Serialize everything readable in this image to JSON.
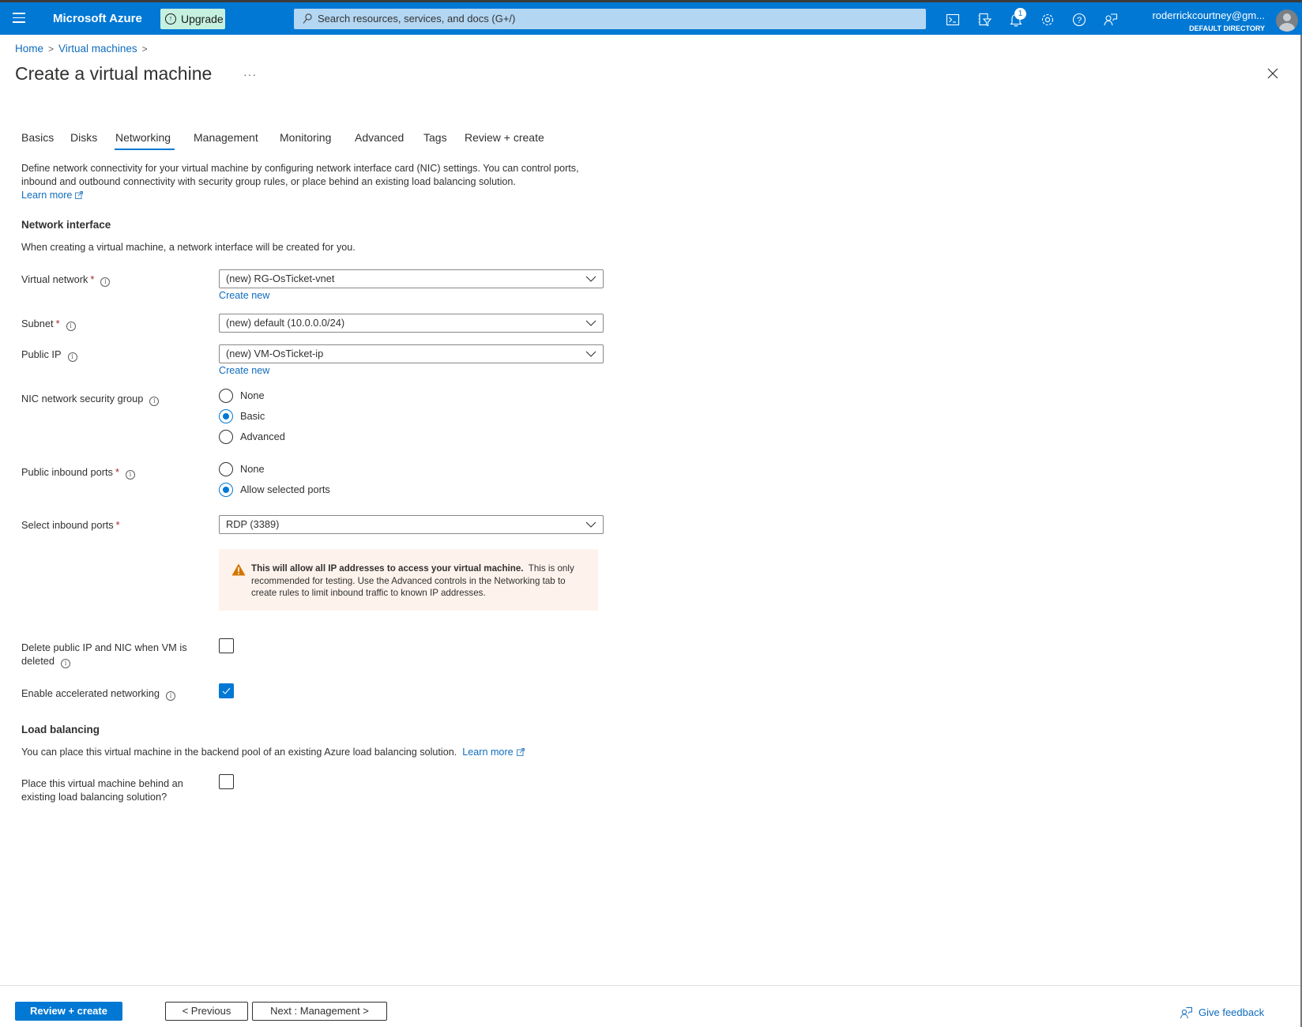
{
  "topbar": {
    "brand": "Microsoft Azure",
    "upgrade_label": "Upgrade",
    "search_placeholder": "Search resources, services, and docs (G+/)",
    "notification_count": "1",
    "user_email": "roderrickcourtney@gm...",
    "user_directory": "DEFAULT DIRECTORY",
    "icons": [
      "cloud-shell-icon",
      "directory-filter-icon",
      "notifications-icon",
      "settings-icon",
      "help-icon",
      "feedback-icon"
    ]
  },
  "breadcrumb": [
    "Home",
    "Virtual machines"
  ],
  "page": {
    "title": "Create a virtual machine",
    "more_label": "···"
  },
  "tabs": [
    {
      "label": "Basics",
      "active": false
    },
    {
      "label": "Disks",
      "active": false
    },
    {
      "label": "Networking",
      "active": true
    },
    {
      "label": "Management",
      "active": false
    },
    {
      "label": "Monitoring",
      "active": false
    },
    {
      "label": "Advanced",
      "active": false
    },
    {
      "label": "Tags",
      "active": false
    },
    {
      "label": "Review + create",
      "active": false
    }
  ],
  "intro": {
    "text": "Define network connectivity for your virtual machine by configuring network interface card (NIC) settings. You can control ports, inbound and outbound connectivity with security group rules, or place behind an existing load balancing solution.",
    "learn_more": "Learn more"
  },
  "network_interface": {
    "heading": "Network interface",
    "subtitle": "When creating a virtual machine, a network interface will be created for you.",
    "virtual_network": {
      "label": "Virtual network",
      "value": "(new) RG-OsTicket-vnet",
      "create_new": "Create new"
    },
    "subnet": {
      "label": "Subnet",
      "value": "(new) default (10.0.0.0/24)"
    },
    "public_ip": {
      "label": "Public IP",
      "value": "(new) VM-OsTicket-ip",
      "create_new": "Create new"
    },
    "nic_nsg": {
      "label": "NIC network security group",
      "options": [
        "None",
        "Basic",
        "Advanced"
      ],
      "selected": "Basic"
    },
    "public_inbound_ports": {
      "label": "Public inbound ports",
      "options": [
        "None",
        "Allow selected ports"
      ],
      "selected": "Allow selected ports"
    },
    "select_inbound_ports": {
      "label": "Select inbound ports",
      "value": "RDP (3389)"
    },
    "warning": {
      "bold": "This will allow all IP addresses to access your virtual machine.",
      "text": "This is only recommended for testing.  Use the Advanced controls in the Networking tab to create rules to limit inbound traffic to known IP addresses."
    },
    "delete_public_ip": {
      "label_line1": "Delete public IP and NIC when VM is",
      "label_line2": "deleted",
      "checked": false
    },
    "accelerated_networking": {
      "label": "Enable accelerated networking",
      "checked": true
    }
  },
  "load_balancing": {
    "heading": "Load balancing",
    "text": "You can place this virtual machine in the backend pool of an existing Azure load balancing solution.",
    "learn_more": "Learn more",
    "place_behind": {
      "label_line1": "Place this virtual machine behind an",
      "label_line2": "existing load balancing solution?",
      "checked": false
    }
  },
  "footer": {
    "review_create": "Review + create",
    "previous": "< Previous",
    "next": "Next : Management >",
    "give_feedback": "Give feedback"
  },
  "colors": {
    "brand_blue": "#0078d4",
    "link_blue": "#0f6cbd",
    "required_red": "#a4262c",
    "warning_bg": "#fdf3ec",
    "warning_icon": "#d47500",
    "upgrade_bg": "#c5f0e0"
  }
}
